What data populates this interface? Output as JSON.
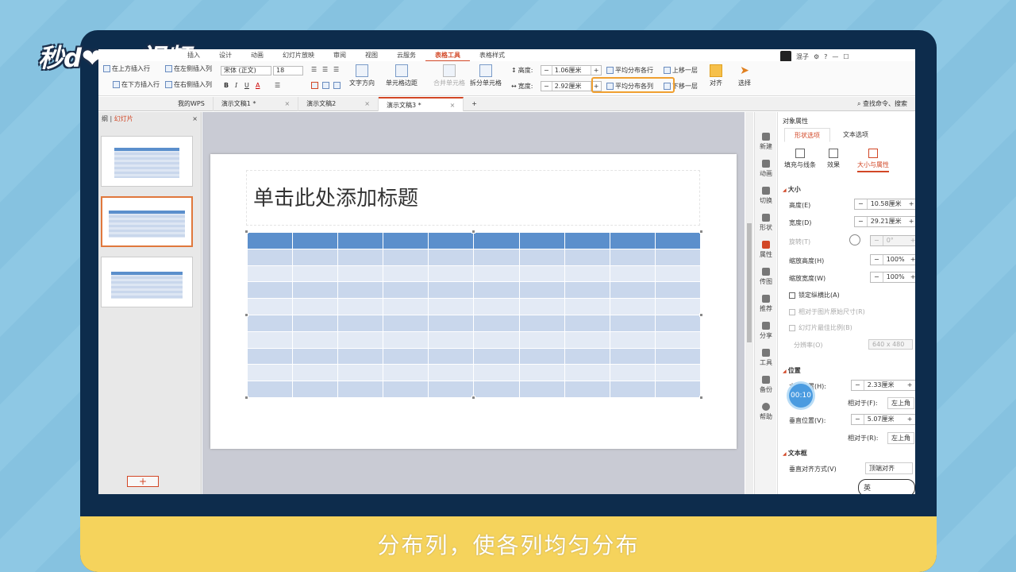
{
  "logo": "秒d❤ng视频",
  "caption": "分布列，使各列均匀分布",
  "ribbon_tabs": [
    "插入",
    "设计",
    "动画",
    "幻灯片放映",
    "审阅",
    "视图",
    "云服务",
    "表格工具",
    "表格样式"
  ],
  "active_tab": "表格工具",
  "topright": {
    "user": "混子",
    "help": "?"
  },
  "ribbon": {
    "ins_above": "在上方插入行",
    "ins_left": "在左侧插入列",
    "ins_below": "在下方插入行",
    "ins_right": "在右侧插入列",
    "font": "宋体 (正文)",
    "size": "18",
    "bold": "B",
    "italic": "I",
    "underline": "U",
    "fontcolor": "A",
    "text_dir": "文字方向",
    "cell_margin": "单元格边距",
    "merge": "合并单元格",
    "split": "拆分单元格",
    "height_label": "高度:",
    "height_value": "1.06厘米",
    "width_label": "宽度:",
    "width_value": "2.92厘米",
    "dist_rows": "平均分布各行",
    "dist_cols": "平均分布各列",
    "move_up": "上移一层",
    "move_down": "下移一层",
    "align": "对齐",
    "select": "选择"
  },
  "doc_tabs": [
    "我的WPS",
    "演示文稿1 *",
    "演示文稿2",
    "演示文稿3 *"
  ],
  "search": "查找命令、搜索",
  "left_panel": {
    "outline": "纲",
    "slides": "幻灯片",
    "close": "×"
  },
  "slide": {
    "title": "单击此处添加标题"
  },
  "iconbar": [
    "新建",
    "动画",
    "切换",
    "形状",
    "属性",
    "传图",
    "推荐",
    "分享",
    "工具",
    "备份",
    "帮助"
  ],
  "props": {
    "header": "对象属性",
    "tab_shape": "形状选项",
    "tab_text": "文本选项",
    "sub_fill": "填充与线条",
    "sub_effect": "效果",
    "sub_size": "大小与属性",
    "sec_size": "大小",
    "height_label": "高度(E)",
    "height_value": "10.58厘米",
    "width_label": "宽度(D)",
    "width_value": "29.21厘米",
    "rotate_label": "旋转(T)",
    "rotate_value": "0°",
    "scale_h_label": "缩放高度(H)",
    "scale_h_value": "100%",
    "scale_w_label": "缩放宽度(W)",
    "scale_w_value": "100%",
    "lock_ratio": "锁定纵横比(A)",
    "rel_orig": "相对于图片原始尺寸(R)",
    "best_scale": "幻灯片最佳比例(B)",
    "res_label": "分辨率(O)",
    "res_value": "640 x 480",
    "sec_pos": "位置",
    "hpos_label": "水平位置(H):",
    "hpos_value": "2.33厘米",
    "rel_to": "相对于(F):",
    "rel_to_value": "左上角",
    "vpos_label": "垂直位置(V):",
    "vpos_value": "5.07厘米",
    "rel_to2": "相对于(R):",
    "rel_to2_value": "左上角",
    "sec_text": "文本框",
    "valign_label": "垂直对齐方式(V)",
    "valign_value": "顶端对齐"
  },
  "timer": "00:10",
  "ime": "英"
}
